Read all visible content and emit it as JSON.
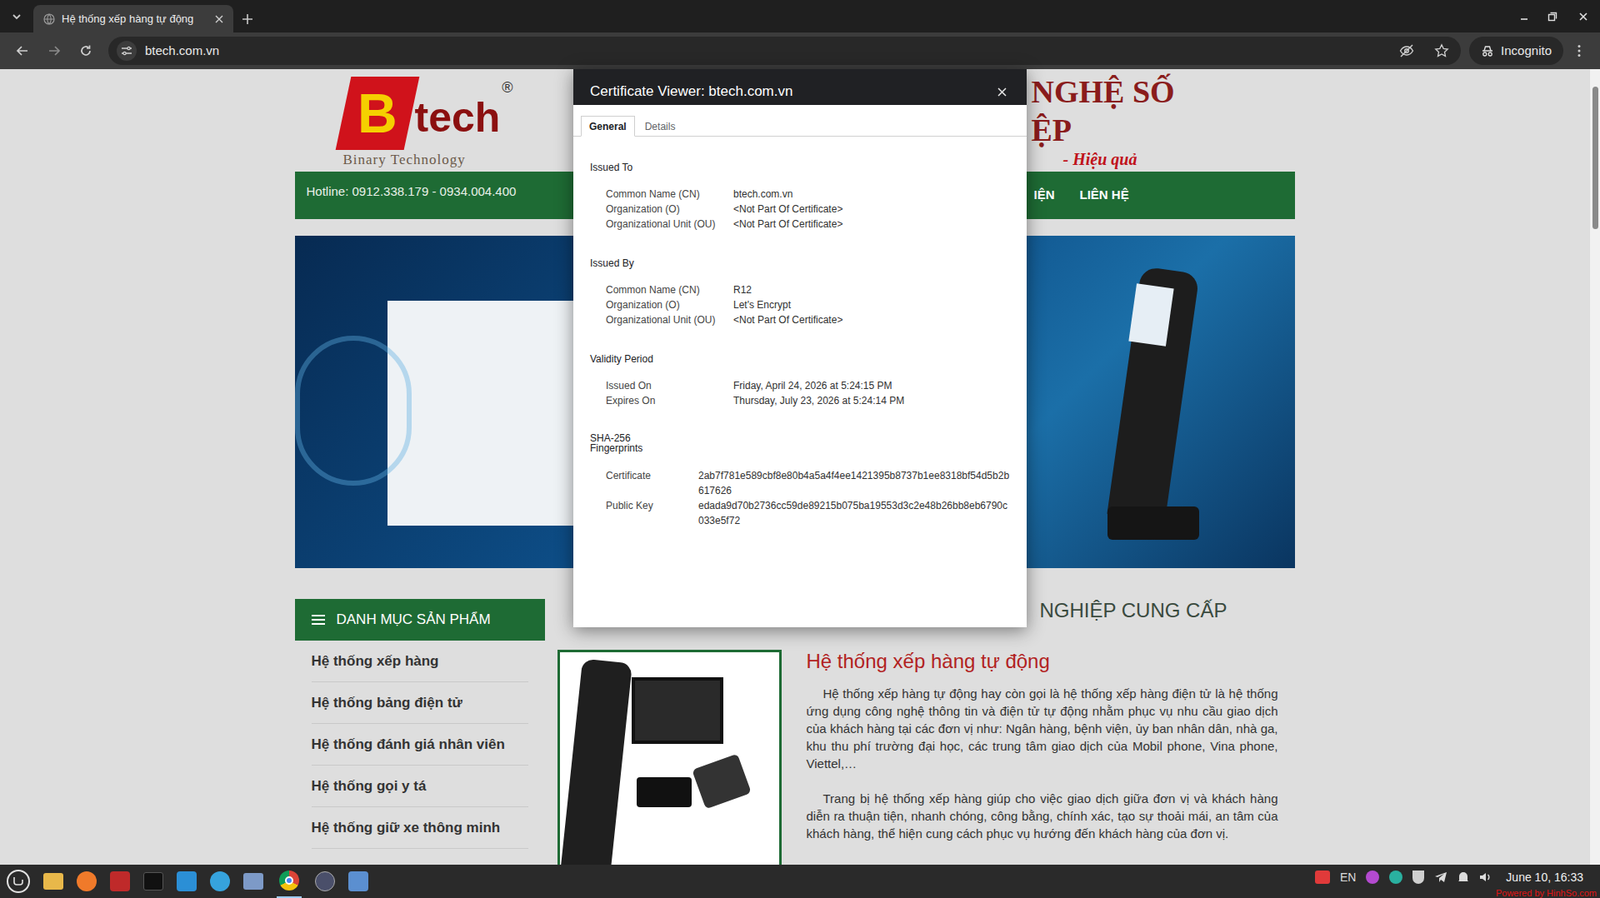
{
  "browser": {
    "tabs": [
      {
        "title": "Hệ thống xếp hàng tự động",
        "selected": true
      }
    ],
    "url": "btech.com.vn",
    "incognito": "Incognito"
  },
  "page": {
    "logo": {
      "mark": "B",
      "text": "tech",
      "registered": "®",
      "tagline": "Binary Technology"
    },
    "slogan": [
      "NGHỆ SỐ",
      "ỆP"
    ],
    "slogan_sub": "- Hiệu quả",
    "hotline": "Hotline: 0912.338.179 - 0934.004.400",
    "menu": [
      "IỆN",
      "LIÊN HỆ"
    ],
    "sidebar": {
      "title": "DANH MỤC SẢN PHẨM",
      "items": [
        "Hệ thống xếp hàng",
        "Hệ thống bảng điện tử",
        "Hệ thống đánh giá nhân viên",
        "Hệ thống gọi y tá",
        "Hệ thống giữ xe thông minh"
      ]
    },
    "section_heading": "NGHIỆP CUNG CẤP",
    "article": {
      "title": "Hệ thống xếp hàng tự động",
      "paragraphs": [
        "Hệ thống xếp hàng tự động hay còn gọi là hệ thống xếp hàng điện tử là hệ thống ứng dụng công nghệ thông tin và điện tử tự động nhằm phục vụ nhu cầu giao dịch của khách hàng tại các đơn vị như: Ngân hàng, bệnh viện, ủy ban nhân dân, nhà ga, khu thu phí trường đại học, các trung tâm giao dịch của Mobil phone, Vina phone, Viettel,…",
        "Trang bị hệ thống xếp hàng giúp cho việc giao dịch giữa đơn vị và khách hàng diễn ra thuận tiện, nhanh chóng, công bằng, chính xác, tạo sự thoải mái, an tâm của khách hàng, thể hiện cung cách phục vụ hướng đến khách hàng của đơn vị."
      ]
    }
  },
  "dialog": {
    "title": "Certificate Viewer: btech.com.vn",
    "tabs": [
      {
        "label": "General",
        "selected": true
      },
      {
        "label": "Details",
        "selected": false
      }
    ],
    "sections": [
      {
        "heading": "Issued To",
        "rows": [
          {
            "label": "Common Name (CN)",
            "value": "btech.com.vn"
          },
          {
            "label": "Organization (O)",
            "value": "<Not Part Of Certificate>"
          },
          {
            "label": "Organizational Unit (OU)",
            "value": "<Not Part Of Certificate>"
          }
        ]
      },
      {
        "heading": "Issued By",
        "rows": [
          {
            "label": "Common Name (CN)",
            "value": "R12"
          },
          {
            "label": "Organization (O)",
            "value": "Let's Encrypt"
          },
          {
            "label": "Organizational Unit (OU)",
            "value": "<Not Part Of Certificate>"
          }
        ]
      },
      {
        "heading": "Validity Period",
        "rows": [
          {
            "label": "Issued On",
            "value": "Friday, April 24, 2026 at 5:24:15 PM"
          },
          {
            "label": "Expires On",
            "value": "Thursday, July 23, 2026 at 5:24:14 PM"
          }
        ]
      }
    ],
    "fingerprints": {
      "heading": "SHA-256 Fingerprints",
      "rows": [
        {
          "label": "Certificate",
          "value": "2ab7f781e589cbf8e80b4a5a4f4ee1421395b8737b1ee8318bf54d5b2b617626"
        },
        {
          "label": "Public Key",
          "value": "edada9d70b2736cc59de89215b075ba19553d3c2e48b26bb8eb6790c033e5f72"
        }
      ]
    }
  },
  "taskbar": {
    "language": "EN",
    "clock": "June 10, 16:33"
  },
  "watermark": "Powered by HinhSo.com"
}
